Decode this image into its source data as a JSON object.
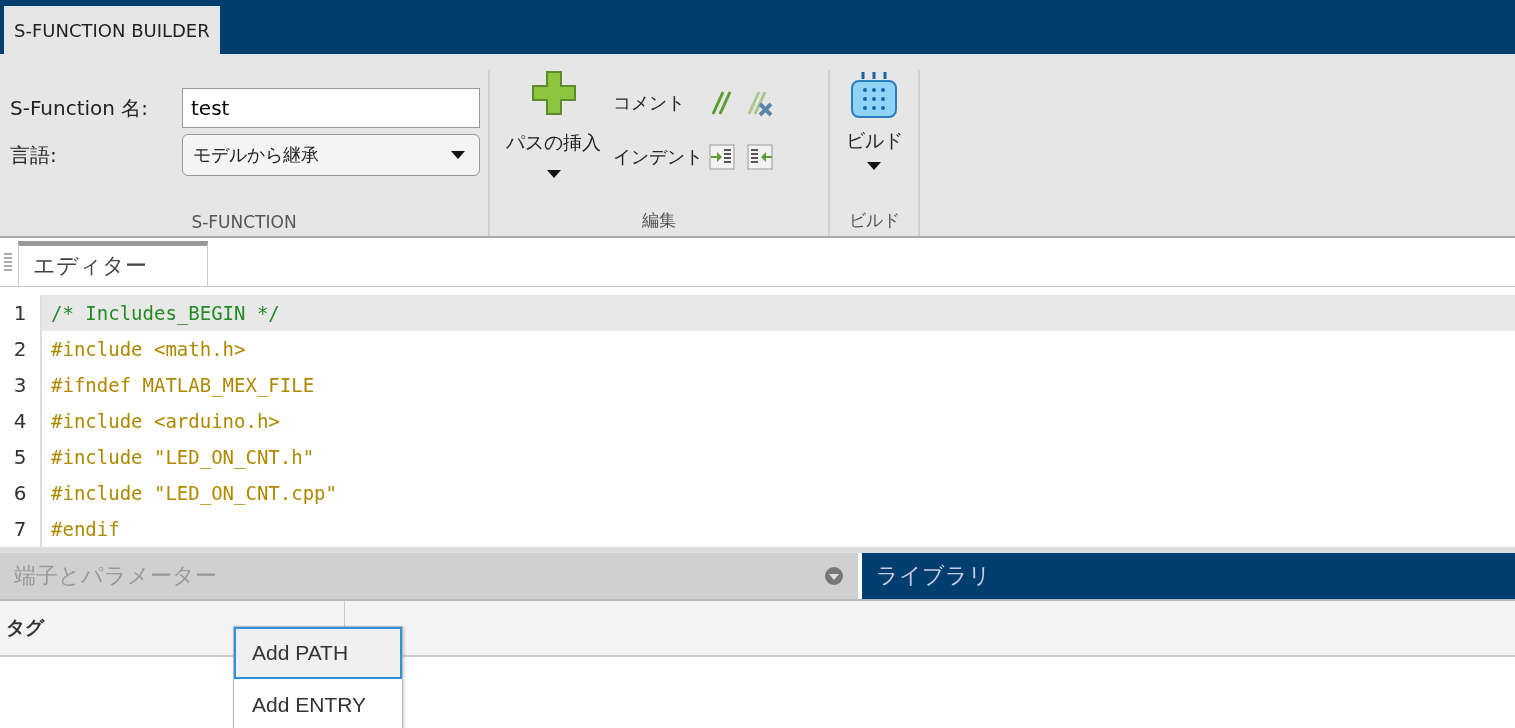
{
  "app_tabs": [
    {
      "label": "S-FUNCTION BUILDER",
      "selected": true
    }
  ],
  "ribbon": {
    "sfunction": {
      "name_label": "S-Function 名:",
      "name_value": "test",
      "language_label": "言語:",
      "language_value": "モデルから継承",
      "group_label": "S-FUNCTION"
    },
    "edit": {
      "insert_path": "パスの挿入",
      "comment": "コメント",
      "indent": "インデント",
      "group_label": "編集"
    },
    "build": {
      "button": "ビルド",
      "group_label": "ビルド"
    }
  },
  "editor": {
    "tabs": [
      {
        "label": "エディター",
        "selected": true
      }
    ],
    "lines": [
      {
        "number": "1",
        "text": "/* Includes_BEGIN */",
        "kind": "comment",
        "selected": true
      },
      {
        "number": "2",
        "text": "#include <math.h>",
        "kind": "directive",
        "selected": false
      },
      {
        "number": "3",
        "text": "#ifndef MATLAB_MEX_FILE",
        "kind": "directive",
        "selected": false
      },
      {
        "number": "4",
        "text": "#include <arduino.h>",
        "kind": "directive",
        "selected": false
      },
      {
        "number": "5",
        "text": "#include \"LED_ON_CNT.h\"",
        "kind": "directive",
        "selected": false
      },
      {
        "number": "6",
        "text": "#include \"LED_ON_CNT.cpp\"",
        "kind": "directive",
        "selected": false
      },
      {
        "number": "7",
        "text": "#endif",
        "kind": "directive",
        "selected": false
      }
    ]
  },
  "bottom_tabs": [
    {
      "label": "端子とパラメーター",
      "selected": false
    },
    {
      "label": "ライブラリ",
      "selected": true
    }
  ],
  "table": {
    "columns": [
      "タグ"
    ]
  },
  "context_menu": [
    {
      "label": "Add PATH",
      "selected": true
    },
    {
      "label": "Add ENTRY",
      "selected": false
    }
  ]
}
